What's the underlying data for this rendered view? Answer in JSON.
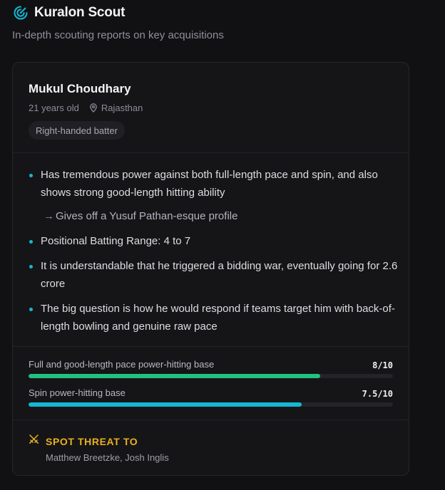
{
  "app": {
    "title": "Kuralon Scout",
    "subtitle": "In-depth scouting reports on key acquisitions",
    "icon": "radar-icon",
    "accent": "#14b8d4"
  },
  "player": {
    "name": "Mukul Choudhary",
    "age": "21 years old",
    "location": "Rajasthan",
    "location_icon": "map-pin-icon",
    "role": "Right-handed batter"
  },
  "notes": [
    {
      "text": "Has tremendous power against both full-length pace and spin, and also shows strong good-length hitting ability"
    },
    {
      "text": "Gives off a Yusuf Pathan-esque profile",
      "sub": true
    },
    {
      "text": "Positional Batting Range: 4 to 7"
    },
    {
      "text": "It is understandable that he triggered a bidding war, eventually going for 2.6 crore"
    },
    {
      "text": "The big question is how he would respond if teams target him with back-of-length bowling and genuine raw pace"
    }
  ],
  "stats": [
    {
      "label": "Full and good-length pace power-hitting base",
      "display": "8/10",
      "score": 8,
      "max": 10,
      "color": "#22c17f"
    },
    {
      "label": "Spin power-hitting base",
      "display": "7.5/10",
      "score": 7.5,
      "max": 10,
      "color": "#14b8d4"
    }
  ],
  "threat": {
    "title": "SPOT THREAT TO",
    "players": "Matthew Breetzke, Josh Inglis",
    "icon": "crossed-swords-icon",
    "color": "#eab020"
  }
}
